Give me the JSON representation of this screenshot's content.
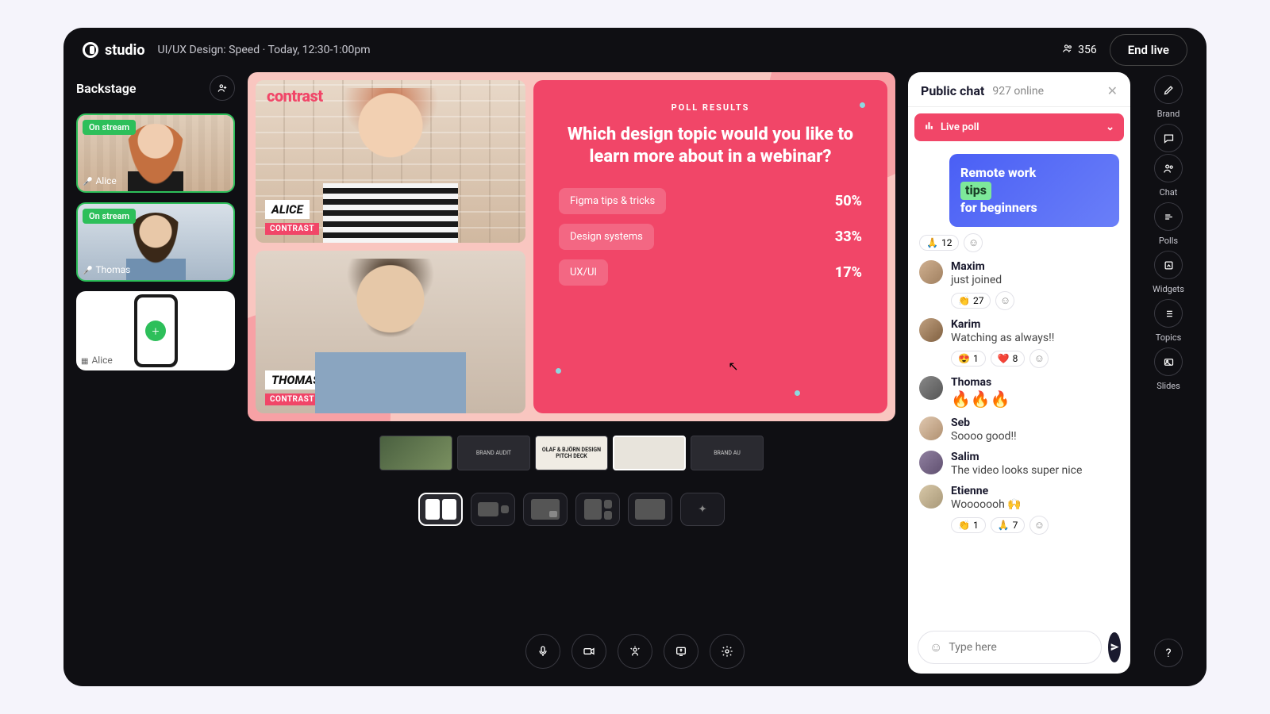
{
  "brand": "studio",
  "session": {
    "title": "UI/UX Design: Speed",
    "time": "Today, 12:30-1:00pm"
  },
  "viewers": "356",
  "end_label": "End live",
  "backstage": {
    "title": "Backstage",
    "thumbs": [
      {
        "badge": "On stream",
        "name": "Alice"
      },
      {
        "badge": "On stream",
        "name": "Thomas"
      },
      {
        "name": "Alice"
      }
    ]
  },
  "stage": {
    "brand": "contrast",
    "speakers": [
      {
        "name": "ALICE",
        "sub": "CONTRAST"
      },
      {
        "name": "THOMAS",
        "sub": "CONTRAST"
      }
    ]
  },
  "poll": {
    "tag": "POLL RESULTS",
    "question": "Which design topic would you like to learn more about in a webinar?",
    "options": [
      {
        "label": "Figma tips & tricks",
        "pct": "50%"
      },
      {
        "label": "Design systems",
        "pct": "33%"
      },
      {
        "label": "UX/UI",
        "pct": "17%"
      }
    ]
  },
  "slidestrip": [
    "",
    "BRAND AUDIT",
    "OLAF & BJÖRN DESIGN PITCH DECK",
    "",
    "BRAND AU"
  ],
  "chat": {
    "title": "Public chat",
    "online": "927 online",
    "livepoll": "Live poll",
    "promo_line1": "Remote work",
    "promo_tip": "tips",
    "promo_line2": "for beginners",
    "placeholder": "Type here",
    "messages": [
      {
        "name": "",
        "text": "",
        "reacts": [
          {
            "e": "🙏",
            "n": "12"
          }
        ]
      },
      {
        "name": "Maxim",
        "text": "just joined",
        "reacts": [
          {
            "e": "👏",
            "n": "27"
          }
        ]
      },
      {
        "name": "Karim",
        "text": "Watching as always!!",
        "reacts": [
          {
            "e": "😍",
            "n": "1"
          },
          {
            "e": "❤️",
            "n": "8"
          }
        ]
      },
      {
        "name": "Thomas",
        "text": "🔥🔥🔥",
        "reacts": []
      },
      {
        "name": "Seb",
        "text": "Soooo good!!",
        "reacts": []
      },
      {
        "name": "Salim",
        "text": "The video looks super nice",
        "reacts": []
      },
      {
        "name": "Etienne",
        "text": "Wooooooh 🙌",
        "reacts": [
          {
            "e": "👏",
            "n": "1"
          },
          {
            "e": "🙏",
            "n": "7"
          }
        ]
      }
    ]
  },
  "rail": [
    "Brand",
    "Chat",
    "Polls",
    "Widgets",
    "Topics",
    "Slides"
  ]
}
